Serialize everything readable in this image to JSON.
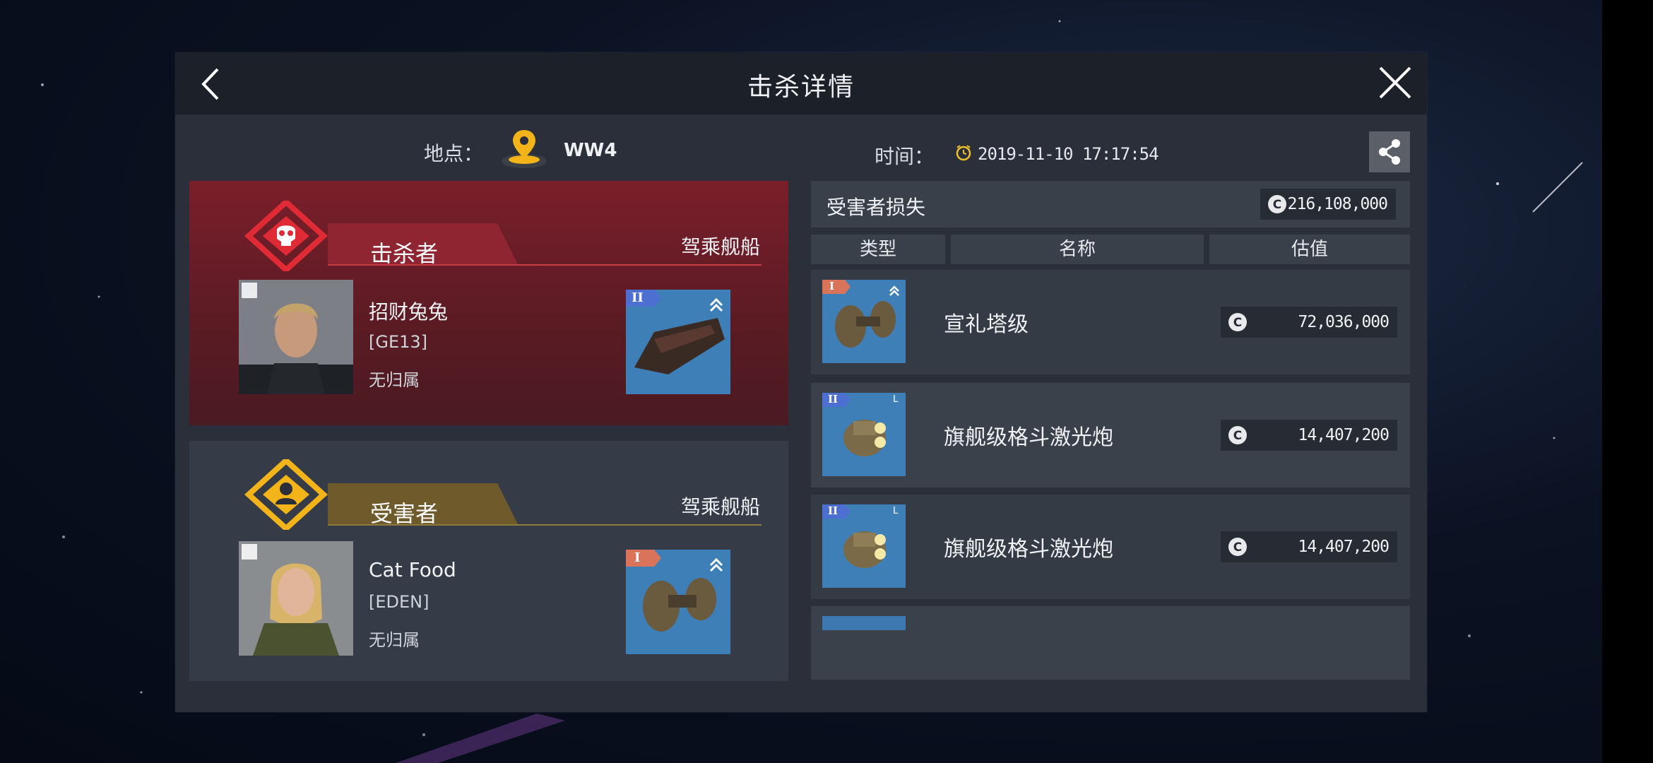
{
  "header": {
    "title": "击杀详情"
  },
  "meta": {
    "location_label": "地点：",
    "location_value": "WW4",
    "time_label": "时间：",
    "time_value": "2019-11-10 17:17:54"
  },
  "killer": {
    "role": "击杀者",
    "ship_label": "驾乘舰船",
    "name": "招财兔兔",
    "corp": "[GE13]",
    "alliance": "无归属",
    "ship_tier": "II"
  },
  "victim": {
    "role": "受害者",
    "ship_label": "驾乘舰船",
    "name": "Cat Food",
    "corp": "[EDEN]",
    "alliance": "无归属",
    "ship_tier": "I"
  },
  "losses": {
    "title": "受害者损失",
    "total": "216,108,000",
    "columns": [
      "类型",
      "名称",
      "估值"
    ],
    "items": [
      {
        "name": "宣礼塔级",
        "value": "72,036,000",
        "tier": "I"
      },
      {
        "name": "旗舰级格斗激光炮",
        "value": "14,407,200",
        "tier": "II",
        "slot": "L"
      },
      {
        "name": "旗舰级格斗激光炮",
        "value": "14,407,200",
        "tier": "II",
        "slot": "L"
      }
    ]
  },
  "colors": {
    "killer_accent": "#e02a35",
    "victim_accent": "#f2b418",
    "location_pin": "#f2b418",
    "panel_bg": "#2a2f39"
  },
  "icons": [
    "back-icon",
    "close-icon",
    "location-pin-icon",
    "clock-icon",
    "share-icon",
    "skull-icon",
    "person-icon",
    "credit-icon"
  ]
}
